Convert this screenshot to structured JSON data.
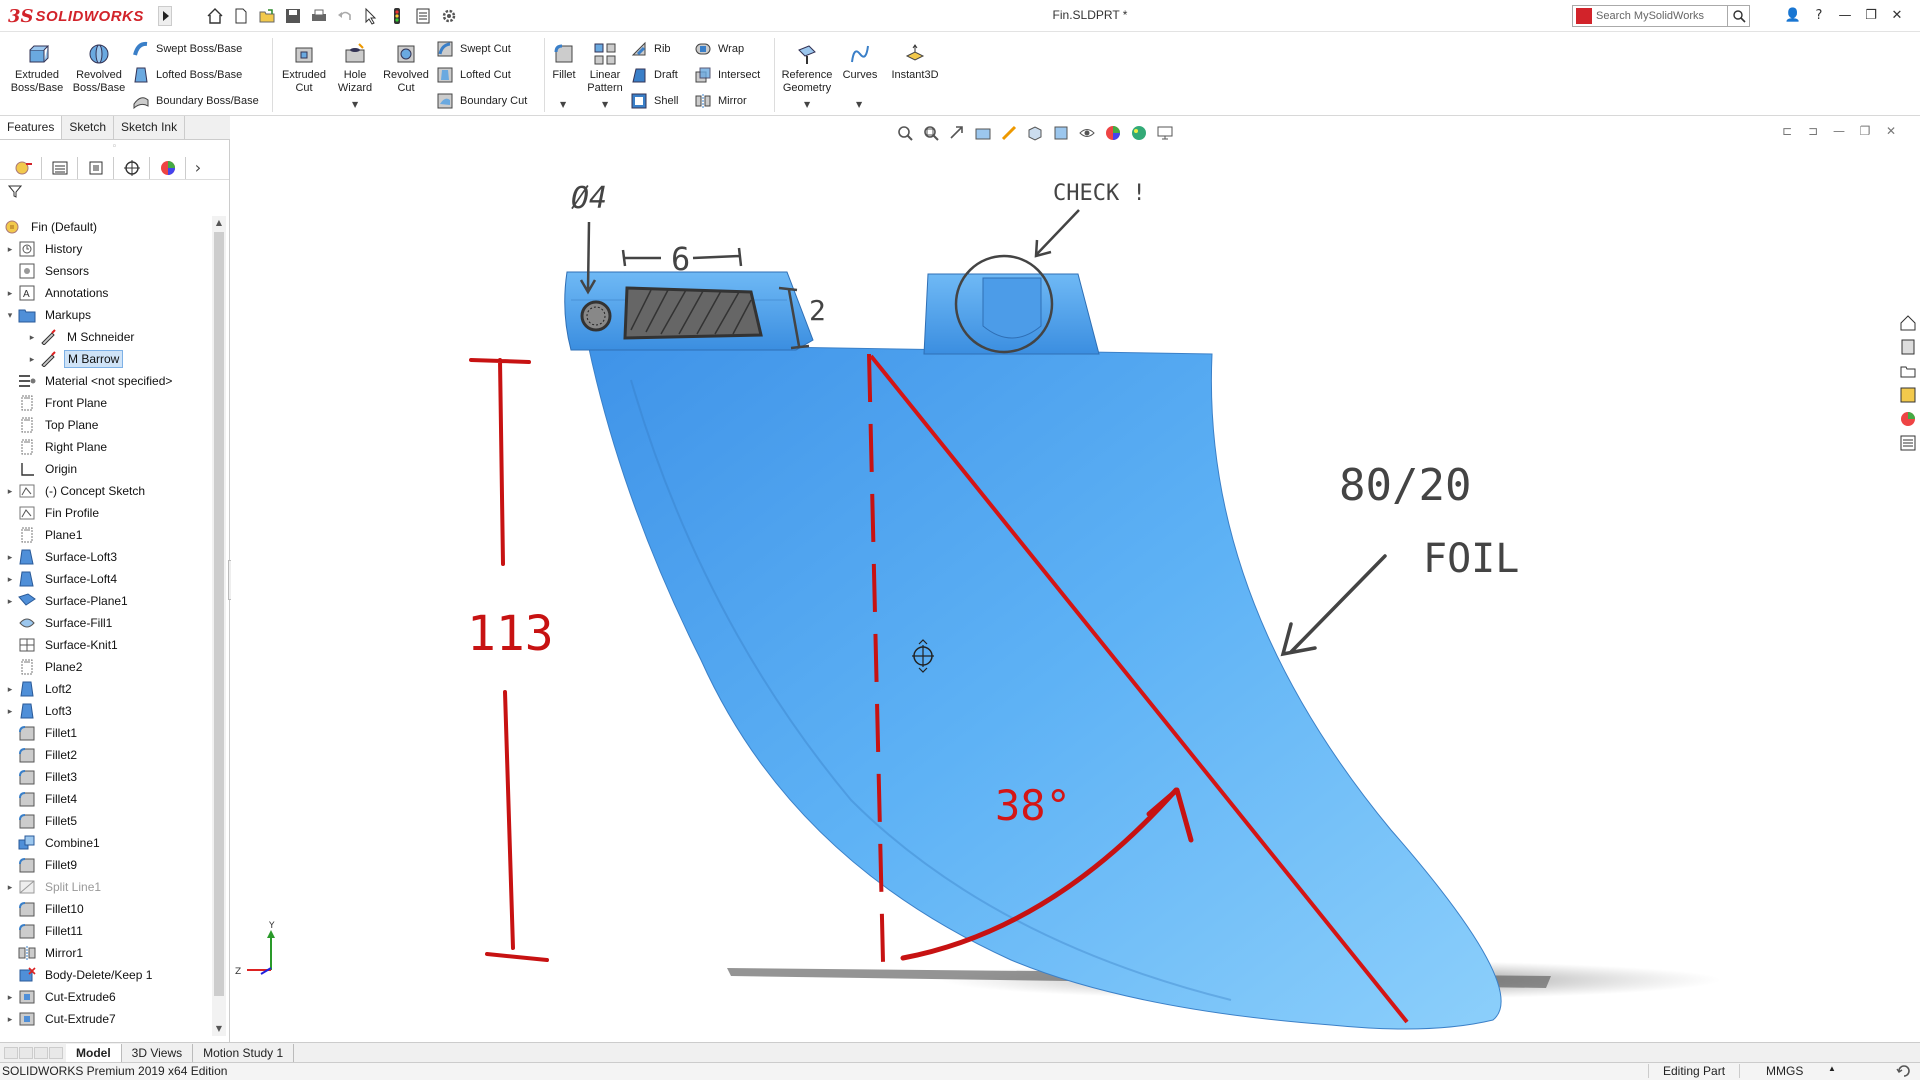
{
  "app": {
    "logo_prefix": "3S",
    "logo_text": "SOLIDWORKS",
    "doc_title": "Fin.SLDPRT *",
    "search_placeholder": "Search MySolidWorks"
  },
  "commands": {
    "extruded_boss": [
      "Extruded",
      "Boss/Base"
    ],
    "revolved_boss": [
      "Revolved",
      "Boss/Base"
    ],
    "swept_boss": "Swept Boss/Base",
    "lofted_boss": "Lofted Boss/Base",
    "boundary_boss": "Boundary Boss/Base",
    "extruded_cut": [
      "Extruded",
      "Cut"
    ],
    "hole_wizard": [
      "Hole",
      "Wizard"
    ],
    "revolved_cut": [
      "Revolved",
      "Cut"
    ],
    "swept_cut": "Swept Cut",
    "lofted_cut": "Lofted Cut",
    "boundary_cut": "Boundary Cut",
    "fillet": "Fillet",
    "linear_pattern": [
      "Linear",
      "Pattern"
    ],
    "rib": "Rib",
    "draft": "Draft",
    "shell": "Shell",
    "wrap": "Wrap",
    "intersect": "Intersect",
    "mirror": "Mirror",
    "reference_geometry": [
      "Reference",
      "Geometry"
    ],
    "curves": "Curves",
    "instant3d": "Instant3D"
  },
  "cm_tabs": [
    "Features",
    "Sketch",
    "Sketch Ink"
  ],
  "tree": {
    "root": "Fin  (Default)",
    "items": [
      {
        "label": "History",
        "exp": "▸",
        "indent": 0,
        "icon": "history-icon"
      },
      {
        "label": "Sensors",
        "exp": "",
        "indent": 0,
        "icon": "sensors-icon"
      },
      {
        "label": "Annotations",
        "exp": "▸",
        "indent": 0,
        "icon": "annotations-icon"
      },
      {
        "label": "Markups",
        "exp": "▾",
        "indent": 0,
        "icon": "folder-icon"
      },
      {
        "label": "M Schneider",
        "exp": "▸",
        "indent": 1,
        "icon": "markup-pen-icon"
      },
      {
        "label": "M Barrow",
        "exp": "▸",
        "indent": 1,
        "icon": "markup-pen-icon",
        "selected": true
      },
      {
        "label": "Material <not specified>",
        "exp": "",
        "indent": 0,
        "icon": "material-icon"
      },
      {
        "label": "Front Plane",
        "exp": "",
        "indent": 0,
        "icon": "plane-icon"
      },
      {
        "label": "Top Plane",
        "exp": "",
        "indent": 0,
        "icon": "plane-icon"
      },
      {
        "label": "Right Plane",
        "exp": "",
        "indent": 0,
        "icon": "plane-icon"
      },
      {
        "label": "Origin",
        "exp": "",
        "indent": 0,
        "icon": "origin-icon"
      },
      {
        "label": "(-) Concept Sketch",
        "exp": "▸",
        "indent": 0,
        "icon": "sketch-icon"
      },
      {
        "label": "Fin Profile",
        "exp": "",
        "indent": 0,
        "icon": "sketch-icon"
      },
      {
        "label": "Plane1",
        "exp": "",
        "indent": 0,
        "icon": "plane-icon"
      },
      {
        "label": "Surface-Loft3",
        "exp": "▸",
        "indent": 0,
        "icon": "surface-loft-icon"
      },
      {
        "label": "Surface-Loft4",
        "exp": "▸",
        "indent": 0,
        "icon": "surface-loft-icon"
      },
      {
        "label": "Surface-Plane1",
        "exp": "▸",
        "indent": 0,
        "icon": "surface-plane-icon"
      },
      {
        "label": "Surface-Fill1",
        "exp": "",
        "indent": 0,
        "icon": "surface-fill-icon"
      },
      {
        "label": "Surface-Knit1",
        "exp": "",
        "indent": 0,
        "icon": "surface-knit-icon"
      },
      {
        "label": "Plane2",
        "exp": "",
        "indent": 0,
        "icon": "plane-icon"
      },
      {
        "label": "Loft2",
        "exp": "▸",
        "indent": 0,
        "icon": "loft-icon"
      },
      {
        "label": "Loft3",
        "exp": "▸",
        "indent": 0,
        "icon": "loft-icon"
      },
      {
        "label": "Fillet1",
        "exp": "",
        "indent": 0,
        "icon": "fillet-icon"
      },
      {
        "label": "Fillet2",
        "exp": "",
        "indent": 0,
        "icon": "fillet-icon"
      },
      {
        "label": "Fillet3",
        "exp": "",
        "indent": 0,
        "icon": "fillet-icon"
      },
      {
        "label": "Fillet4",
        "exp": "",
        "indent": 0,
        "icon": "fillet-icon"
      },
      {
        "label": "Fillet5",
        "exp": "",
        "indent": 0,
        "icon": "fillet-icon"
      },
      {
        "label": "Combine1",
        "exp": "",
        "indent": 0,
        "icon": "combine-icon"
      },
      {
        "label": "Fillet9",
        "exp": "",
        "indent": 0,
        "icon": "fillet-icon"
      },
      {
        "label": "Split Line1",
        "exp": "▸",
        "indent": 0,
        "icon": "split-line-icon",
        "dim": true
      },
      {
        "label": "Fillet10",
        "exp": "",
        "indent": 0,
        "icon": "fillet-icon"
      },
      {
        "label": "Fillet11",
        "exp": "",
        "indent": 0,
        "icon": "fillet-icon"
      },
      {
        "label": "Mirror1",
        "exp": "",
        "indent": 0,
        "icon": "mirror-icon"
      },
      {
        "label": "Body-Delete/Keep 1",
        "exp": "",
        "indent": 0,
        "icon": "body-delete-icon"
      },
      {
        "label": "Cut-Extrude6",
        "exp": "▸",
        "indent": 0,
        "icon": "cut-extrude-icon"
      },
      {
        "label": "Cut-Extrude7",
        "exp": "▸",
        "indent": 0,
        "icon": "cut-extrude-icon"
      }
    ]
  },
  "markup": {
    "diameter": "Ø4",
    "width": "6",
    "height": "2",
    "check": "CHECK !",
    "length": "113",
    "angle": "38°",
    "foil_ratio": "80/20",
    "foil": "FOIL"
  },
  "bottom_tabs": [
    "Model",
    "3D Views",
    "Motion Study 1"
  ],
  "status": {
    "edition": "SOLIDWORKS Premium 2019 x64 Edition",
    "mode": "Editing Part",
    "units": "MMGS",
    "units_arrow": "▲"
  },
  "colors": {
    "brand_red": "#d2232a",
    "model_blue": "#4da3f0",
    "markup_red": "#cc1111",
    "markup_gray": "#444444"
  }
}
